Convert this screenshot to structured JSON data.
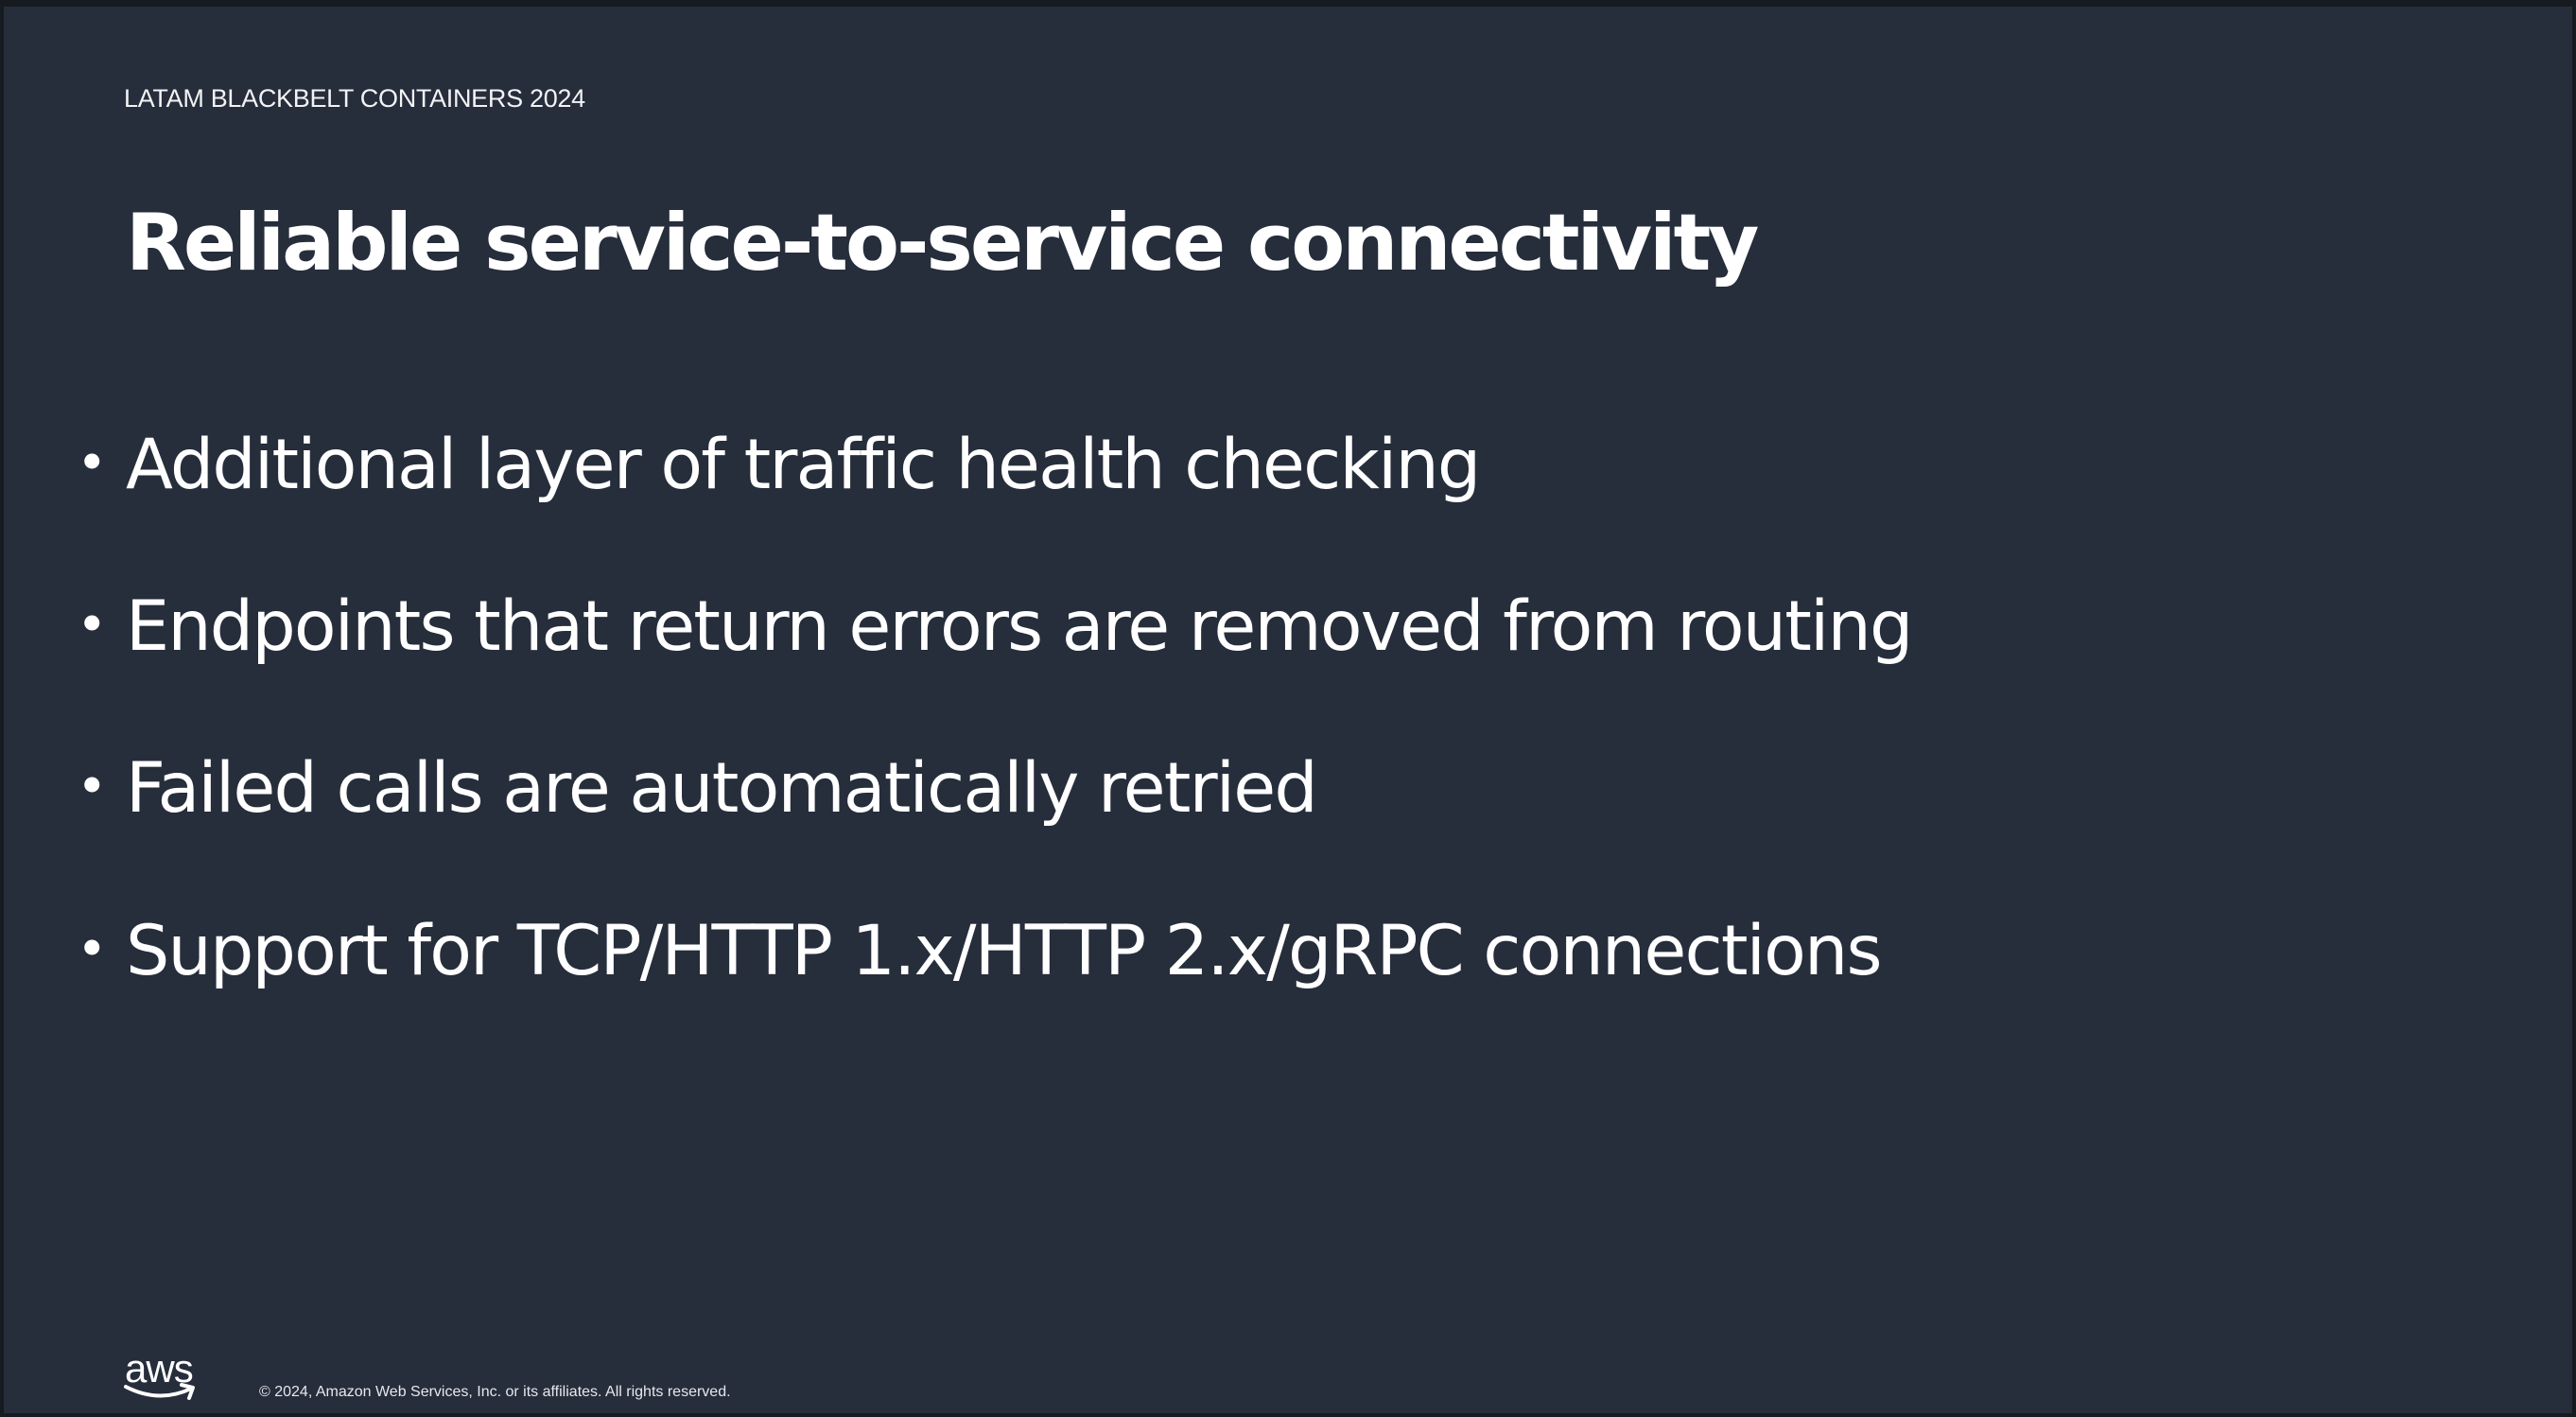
{
  "slide": {
    "eyebrow": "LATAM BLACKBELT CONTAINERS 2024",
    "title": "Reliable service-to-service connectivity",
    "bullet_glyph": "•",
    "bullets": [
      "Additional layer of traffic health checking",
      "Endpoints that return errors are removed from routing",
      "Failed calls are automatically retried",
      "Support for TCP/HTTP 1.x/HTTP 2.x/gRPC connections"
    ],
    "footer": {
      "logo_text": "aws",
      "logo_icon": "aws-smile-logo",
      "copyright": "© 2024, Amazon Web Services, Inc. or its affiliates. All rights reserved."
    }
  },
  "colors": {
    "frame": "#161a21",
    "background": "#262d3b",
    "text": "#ffffff"
  }
}
